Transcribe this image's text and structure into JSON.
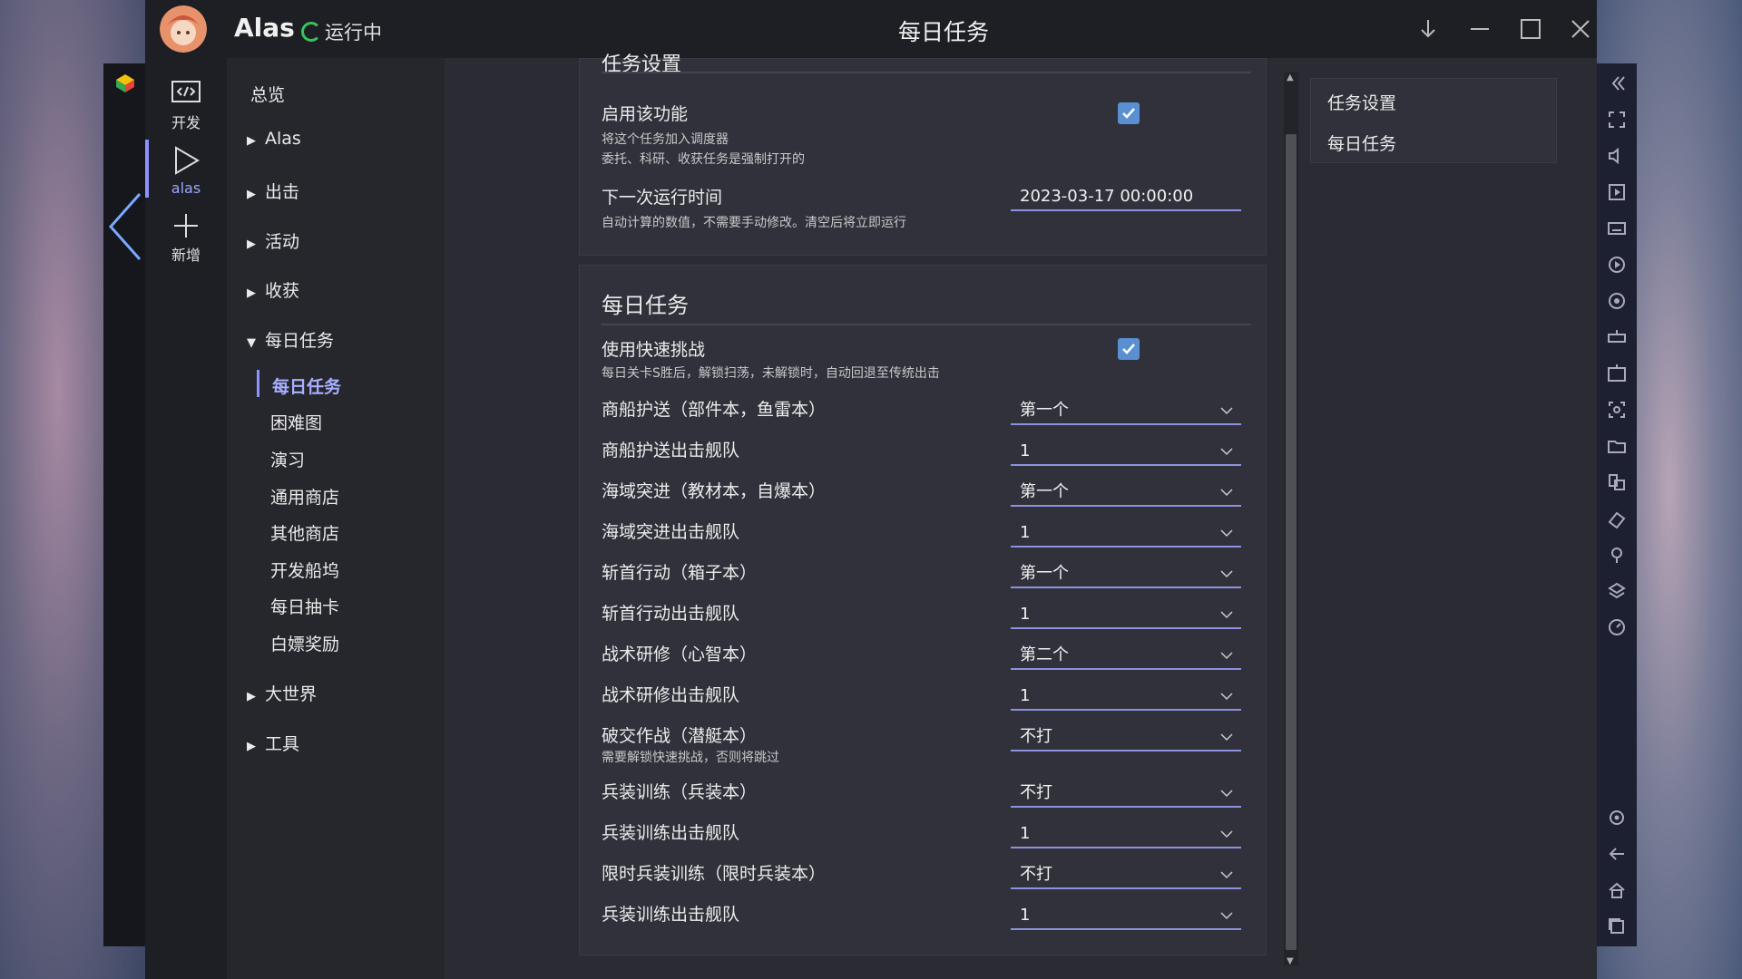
{
  "app": {
    "name": "Alas",
    "status": "运行中",
    "window_title": "每日任务"
  },
  "leftbar": {
    "items": [
      {
        "label": "开发",
        "icon": "code-icon"
      },
      {
        "label": "alas",
        "icon": "play-icon"
      },
      {
        "label": "新增",
        "icon": "plus-icon"
      }
    ]
  },
  "nav": {
    "overview": "总览",
    "groups": [
      "Alas",
      "出击",
      "活动",
      "收获"
    ],
    "open_group": "每日任务",
    "subitems": [
      "每日任务",
      "困难图",
      "演习",
      "通用商店",
      "其他商店",
      "开发船坞",
      "每日抽卡",
      "白嫖奖励"
    ],
    "tail_groups": [
      "大世界",
      "工具"
    ]
  },
  "task_settings": {
    "title": "任务设置",
    "enable_label": "启用该功能",
    "enable_help_1": "将这个任务加入调度器",
    "enable_help_2": "委托、科研、收获任务是强制打开的",
    "enable_checked": true,
    "next_run_label": "下一次运行时间",
    "next_run_value": "2023-03-17 00:00:00",
    "next_run_help": "自动计算的数值，不需要手动修改。清空后将立即运行"
  },
  "daily": {
    "title": "每日任务",
    "quick_label": "使用快速挑战",
    "quick_help": "每日关卡S胜后，解锁扫荡，未解锁时，自动回退至传统出击",
    "quick_checked": true,
    "rows": [
      {
        "label": "商船护送（部件本，鱼雷本）",
        "value": "第一个"
      },
      {
        "label": "商船护送出击舰队",
        "value": "1"
      },
      {
        "label": "海域突进（教材本，自爆本）",
        "value": "第一个"
      },
      {
        "label": "海域突进出击舰队",
        "value": "1"
      },
      {
        "label": "斩首行动（箱子本）",
        "value": "第一个"
      },
      {
        "label": "斩首行动出击舰队",
        "value": "1"
      },
      {
        "label": "战术研修（心智本）",
        "value": "第二个"
      },
      {
        "label": "战术研修出击舰队",
        "value": "1"
      },
      {
        "label": "破交作战（潜艇本）",
        "value": "不打"
      },
      {
        "label": "兵装训练（兵装本）",
        "value": "不打"
      },
      {
        "label": "兵装训练出击舰队",
        "value": "1"
      },
      {
        "label": "限时兵装训练（限时兵装本）",
        "value": "不打"
      },
      {
        "label": "兵装训练出击舰队",
        "value": "1"
      }
    ],
    "submarine_help": "需要解锁快速挑战，否则将跳过"
  },
  "toc": {
    "items": [
      "任务设置",
      "每日任务"
    ]
  },
  "colors": {
    "accent": "#8b93ff",
    "checkbox": "#5a8fd1",
    "running": "#3ac25b"
  }
}
